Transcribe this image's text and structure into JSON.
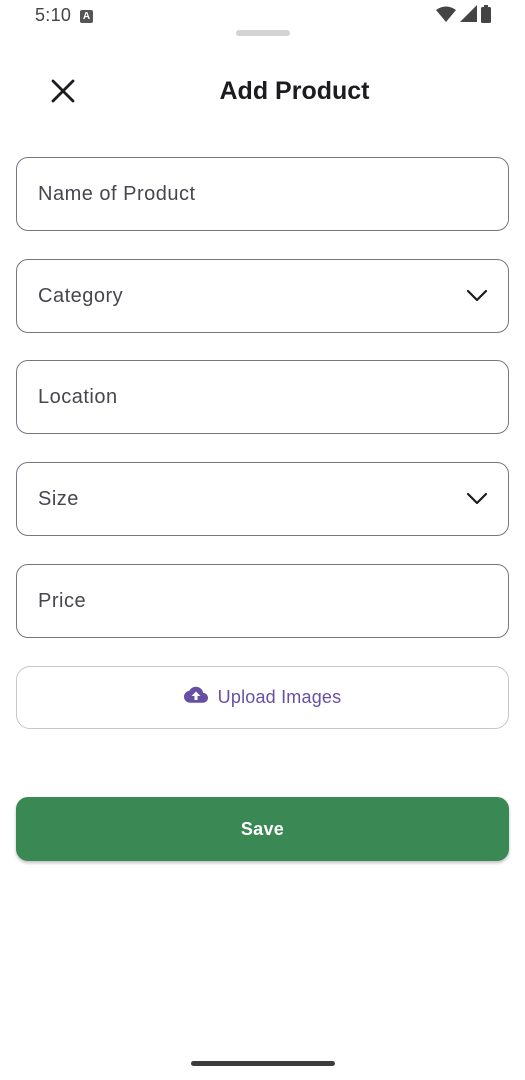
{
  "status_bar": {
    "time": "5:10",
    "notification_icon_letter": "A",
    "icons": [
      "wifi-icon",
      "signal-icon",
      "battery-icon"
    ]
  },
  "header": {
    "title": "Add Product",
    "close_icon": "close-icon"
  },
  "form": {
    "fields": [
      {
        "placeholder": "Name of Product",
        "type": "text"
      },
      {
        "placeholder": "Category",
        "type": "dropdown"
      },
      {
        "placeholder": "Location",
        "type": "text"
      },
      {
        "placeholder": "Size",
        "type": "dropdown"
      },
      {
        "placeholder": "Price",
        "type": "text"
      }
    ],
    "upload": {
      "label": "Upload Images",
      "icon": "cloud-upload-icon",
      "color": "#6750a4"
    },
    "save": {
      "label": "Save",
      "color": "#3a8853"
    }
  }
}
